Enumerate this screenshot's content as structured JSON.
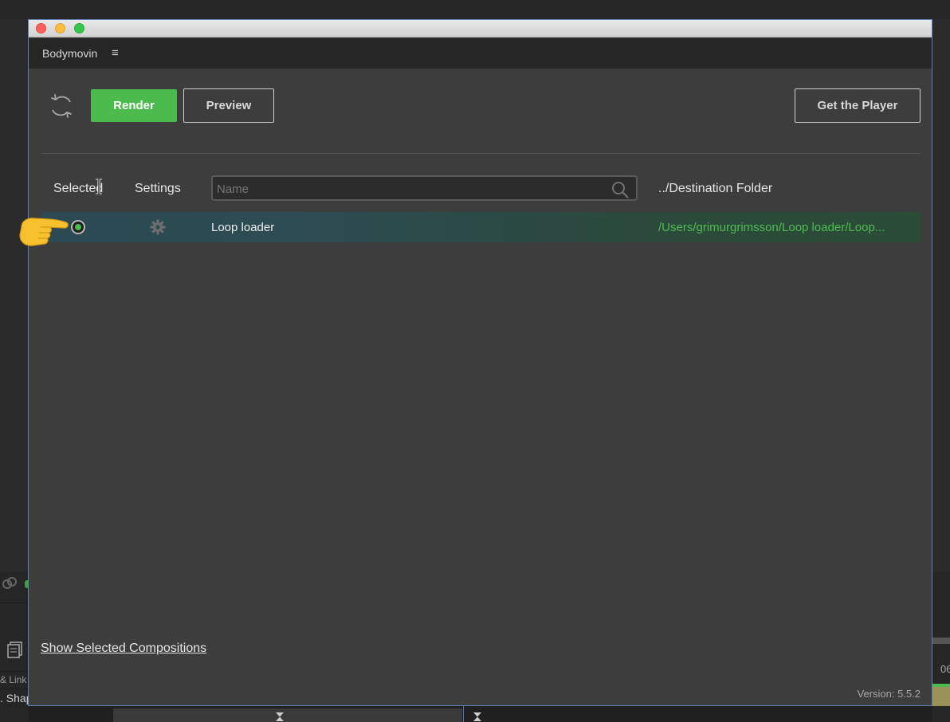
{
  "window": {
    "panel_title": "Bodymovin",
    "menu_icon": "hamburger-menu-icon"
  },
  "toolbar": {
    "refresh_icon": "refresh-icon",
    "render_label": "Render",
    "preview_label": "Preview",
    "get_player_label": "Get the Player",
    "render_color": "#4cbb4e"
  },
  "table": {
    "col_selected": "Selected",
    "col_settings": "Settings",
    "search_placeholder": "Name",
    "search_icon": "search-icon",
    "col_destination": "../Destination Folder",
    "rows": [
      {
        "selected": true,
        "settings_icon": "gear-icon",
        "name": "Loop loader",
        "destination": "/Users/grimurgrimsson/Loop loader/Loop..."
      }
    ]
  },
  "footer": {
    "show_selected_label": "Show Selected Compositions",
    "version": "Version: 5.5.2"
  },
  "background_app": {
    "left_label_1": "& Link",
    "left_label_2": ". Shap",
    "right_label": "06"
  },
  "colors": {
    "accent_green": "#4cbb4e",
    "destination_text": "#50bb52",
    "window_border": "#5b7fb6"
  }
}
